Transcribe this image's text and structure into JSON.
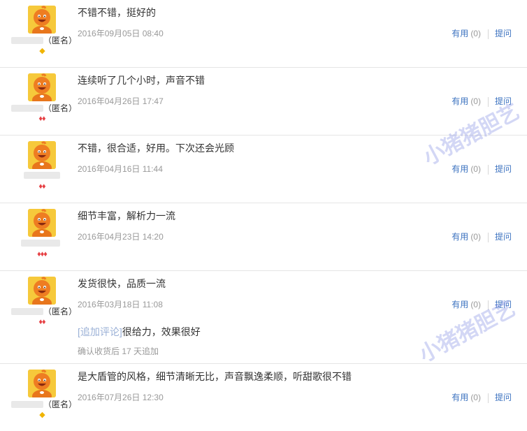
{
  "reviews": [
    {
      "content": "不错不错，挺好的",
      "date": "2016年09月05日 08:40",
      "nickname": "（匿名）",
      "level": "◆",
      "level_color": "gold",
      "useful_label": "有用",
      "useful_count": "(0)",
      "ask_label": "提问"
    },
    {
      "content": "连续听了几个小时，声音不错",
      "date": "2016年04月26日 17:47",
      "nickname": "（匿名）",
      "level": "♦♦",
      "level_color": "red",
      "useful_label": "有用",
      "useful_count": "(0)",
      "ask_label": "提问"
    },
    {
      "content": "不错，很合适，好用。下次还会光顾",
      "date": "2016年04月16日 11:44",
      "nickname": "",
      "level": "♦♦",
      "level_color": "red",
      "useful_label": "有用",
      "useful_count": "(0)",
      "ask_label": "提问"
    },
    {
      "content": "细节丰富，解析力一流",
      "date": "2016年04月23日 14:20",
      "nickname": "",
      "level": "♦♦♦",
      "level_color": "red",
      "useful_label": "有用",
      "useful_count": "(0)",
      "ask_label": "提问"
    },
    {
      "content": "发货很快，品质一流",
      "date": "2016年03月18日 11:08",
      "nickname": "（匿名）",
      "level": "♦♦",
      "level_color": "red",
      "useful_label": "有用",
      "useful_count": "(0)",
      "ask_label": "提问",
      "append_tag": "[追加评论]",
      "append_text": "很给力，效果很好",
      "append_note": "确认收货后 17 天追加"
    },
    {
      "content": "是大盾管的风格，细节清晰无比，声音飘逸柔顺，听甜歌很不错",
      "date": "2016年07月26日 12:30",
      "nickname": "（匿名）",
      "level": "◆",
      "level_color": "gold",
      "useful_label": "有用",
      "useful_count": "(0)",
      "ask_label": "提问"
    }
  ],
  "watermark": "小猪猪胆艺"
}
